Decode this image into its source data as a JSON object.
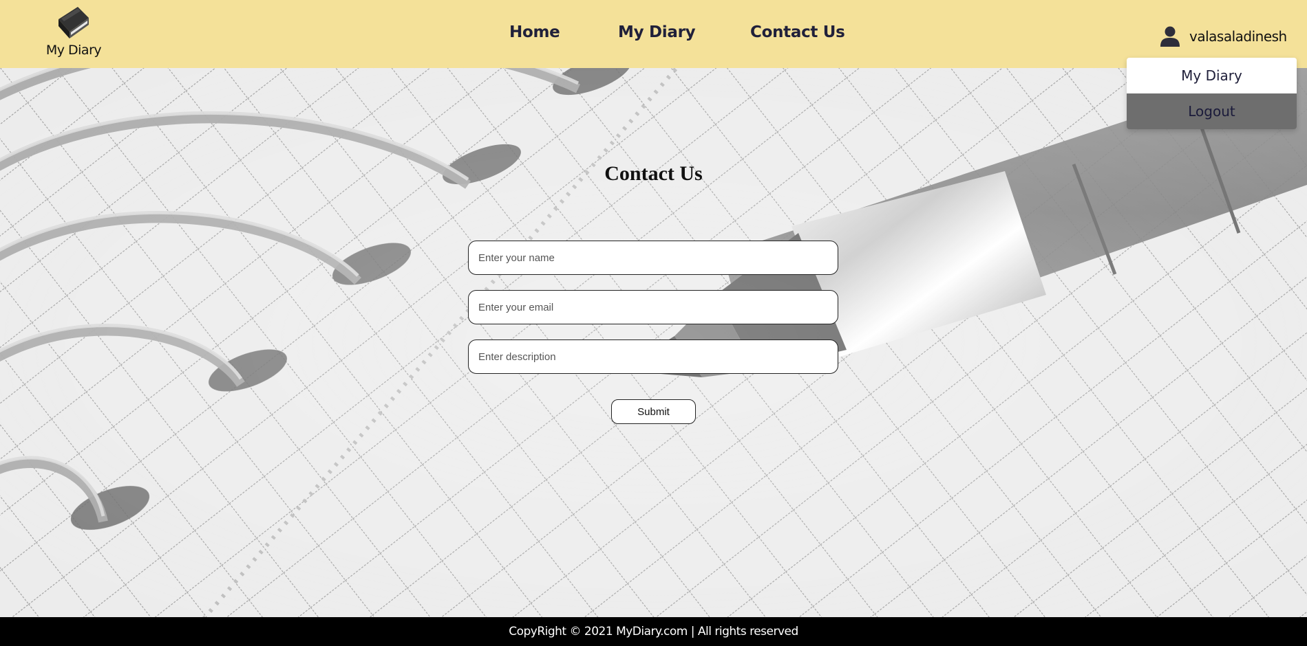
{
  "header": {
    "logo_text": "My Diary",
    "logo_icon": "book-icon",
    "nav": [
      {
        "label": "Home"
      },
      {
        "label": "My Diary"
      },
      {
        "label": "Contact Us"
      }
    ],
    "user": {
      "icon": "user-icon",
      "name": "valasaladinesh"
    },
    "background_color": "#f4e199"
  },
  "dropdown": {
    "items": [
      {
        "label": "My Diary"
      },
      {
        "label": "Logout"
      }
    ]
  },
  "contact_form": {
    "title": "Contact Us",
    "name_placeholder": "Enter your name",
    "email_placeholder": "Enter your email",
    "description_placeholder": "Enter description",
    "submit_label": "Submit"
  },
  "footer": {
    "text": "CopyRight © 2021 MyDiary.com | All rights reserved"
  }
}
